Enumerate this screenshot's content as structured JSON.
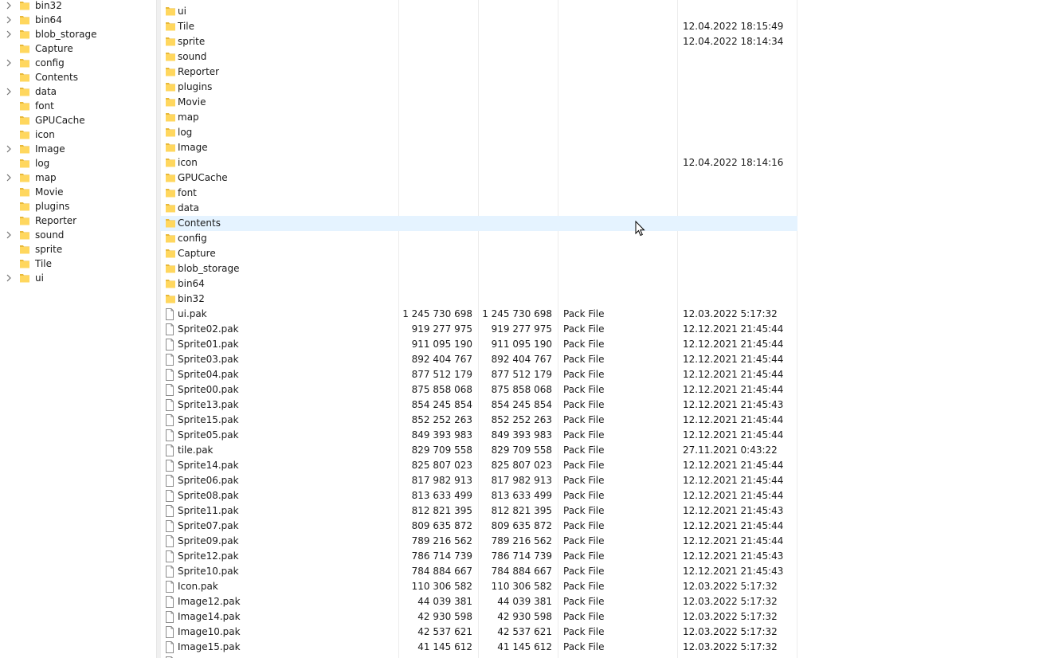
{
  "tree": [
    {
      "label": "bin32",
      "expandable": true
    },
    {
      "label": "bin64",
      "expandable": true
    },
    {
      "label": "blob_storage",
      "expandable": true
    },
    {
      "label": "Capture",
      "expandable": false
    },
    {
      "label": "config",
      "expandable": true
    },
    {
      "label": "Contents",
      "expandable": false
    },
    {
      "label": "data",
      "expandable": true
    },
    {
      "label": "font",
      "expandable": false
    },
    {
      "label": "GPUCache",
      "expandable": false
    },
    {
      "label": "icon",
      "expandable": false
    },
    {
      "label": "Image",
      "expandable": true
    },
    {
      "label": "log",
      "expandable": false
    },
    {
      "label": "map",
      "expandable": true
    },
    {
      "label": "Movie",
      "expandable": false
    },
    {
      "label": "plugins",
      "expandable": false
    },
    {
      "label": "Reporter",
      "expandable": false
    },
    {
      "label": "sound",
      "expandable": true
    },
    {
      "label": "sprite",
      "expandable": false
    },
    {
      "label": "Tile",
      "expandable": false
    },
    {
      "label": "ui",
      "expandable": true
    }
  ],
  "files": [
    {
      "name": "ui",
      "kind": "folder",
      "size1": "",
      "size2": "",
      "type": "",
      "date": ""
    },
    {
      "name": "Tile",
      "kind": "folder",
      "size1": "",
      "size2": "",
      "type": "",
      "date": "12.04.2022 18:15:49"
    },
    {
      "name": "sprite",
      "kind": "folder",
      "size1": "",
      "size2": "",
      "type": "",
      "date": "12.04.2022 18:14:34"
    },
    {
      "name": "sound",
      "kind": "folder",
      "size1": "",
      "size2": "",
      "type": "",
      "date": ""
    },
    {
      "name": "Reporter",
      "kind": "folder",
      "size1": "",
      "size2": "",
      "type": "",
      "date": ""
    },
    {
      "name": "plugins",
      "kind": "folder",
      "size1": "",
      "size2": "",
      "type": "",
      "date": ""
    },
    {
      "name": "Movie",
      "kind": "folder",
      "size1": "",
      "size2": "",
      "type": "",
      "date": ""
    },
    {
      "name": "map",
      "kind": "folder",
      "size1": "",
      "size2": "",
      "type": "",
      "date": ""
    },
    {
      "name": "log",
      "kind": "folder",
      "size1": "",
      "size2": "",
      "type": "",
      "date": ""
    },
    {
      "name": "Image",
      "kind": "folder",
      "size1": "",
      "size2": "",
      "type": "",
      "date": ""
    },
    {
      "name": "icon",
      "kind": "folder",
      "size1": "",
      "size2": "",
      "type": "",
      "date": "12.04.2022 18:14:16"
    },
    {
      "name": "GPUCache",
      "kind": "folder",
      "size1": "",
      "size2": "",
      "type": "",
      "date": ""
    },
    {
      "name": "font",
      "kind": "folder",
      "size1": "",
      "size2": "",
      "type": "",
      "date": ""
    },
    {
      "name": "data",
      "kind": "folder",
      "size1": "",
      "size2": "",
      "type": "",
      "date": ""
    },
    {
      "name": "Contents",
      "kind": "folder",
      "size1": "",
      "size2": "",
      "type": "",
      "date": "",
      "hover": true
    },
    {
      "name": "config",
      "kind": "folder",
      "size1": "",
      "size2": "",
      "type": "",
      "date": ""
    },
    {
      "name": "Capture",
      "kind": "folder",
      "size1": "",
      "size2": "",
      "type": "",
      "date": ""
    },
    {
      "name": "blob_storage",
      "kind": "folder",
      "size1": "",
      "size2": "",
      "type": "",
      "date": ""
    },
    {
      "name": "bin64",
      "kind": "folder",
      "size1": "",
      "size2": "",
      "type": "",
      "date": ""
    },
    {
      "name": "bin32",
      "kind": "folder",
      "size1": "",
      "size2": "",
      "type": "",
      "date": ""
    },
    {
      "name": "ui.pak",
      "kind": "file",
      "size1": "1 245 730 698",
      "size2": "1 245 730 698",
      "type": "Pack File",
      "date": "12.03.2022 5:17:32"
    },
    {
      "name": "Sprite02.pak",
      "kind": "file",
      "size1": "919 277 975",
      "size2": "919 277 975",
      "type": "Pack File",
      "date": "12.12.2021 21:45:44"
    },
    {
      "name": "Sprite01.pak",
      "kind": "file",
      "size1": "911 095 190",
      "size2": "911 095 190",
      "type": "Pack File",
      "date": "12.12.2021 21:45:44"
    },
    {
      "name": "Sprite03.pak",
      "kind": "file",
      "size1": "892 404 767",
      "size2": "892 404 767",
      "type": "Pack File",
      "date": "12.12.2021 21:45:44"
    },
    {
      "name": "Sprite04.pak",
      "kind": "file",
      "size1": "877 512 179",
      "size2": "877 512 179",
      "type": "Pack File",
      "date": "12.12.2021 21:45:44"
    },
    {
      "name": "Sprite00.pak",
      "kind": "file",
      "size1": "875 858 068",
      "size2": "875 858 068",
      "type": "Pack File",
      "date": "12.12.2021 21:45:44"
    },
    {
      "name": "Sprite13.pak",
      "kind": "file",
      "size1": "854 245 854",
      "size2": "854 245 854",
      "type": "Pack File",
      "date": "12.12.2021 21:45:43"
    },
    {
      "name": "Sprite15.pak",
      "kind": "file",
      "size1": "852 252 263",
      "size2": "852 252 263",
      "type": "Pack File",
      "date": "12.12.2021 21:45:44"
    },
    {
      "name": "Sprite05.pak",
      "kind": "file",
      "size1": "849 393 983",
      "size2": "849 393 983",
      "type": "Pack File",
      "date": "12.12.2021 21:45:44"
    },
    {
      "name": "tile.pak",
      "kind": "file",
      "size1": "829 709 558",
      "size2": "829 709 558",
      "type": "Pack File",
      "date": "27.11.2021 0:43:22"
    },
    {
      "name": "Sprite14.pak",
      "kind": "file",
      "size1": "825 807 023",
      "size2": "825 807 023",
      "type": "Pack File",
      "date": "12.12.2021 21:45:44"
    },
    {
      "name": "Sprite06.pak",
      "kind": "file",
      "size1": "817 982 913",
      "size2": "817 982 913",
      "type": "Pack File",
      "date": "12.12.2021 21:45:44"
    },
    {
      "name": "Sprite08.pak",
      "kind": "file",
      "size1": "813 633 499",
      "size2": "813 633 499",
      "type": "Pack File",
      "date": "12.12.2021 21:45:44"
    },
    {
      "name": "Sprite11.pak",
      "kind": "file",
      "size1": "812 821 395",
      "size2": "812 821 395",
      "type": "Pack File",
      "date": "12.12.2021 21:45:43"
    },
    {
      "name": "Sprite07.pak",
      "kind": "file",
      "size1": "809 635 872",
      "size2": "809 635 872",
      "type": "Pack File",
      "date": "12.12.2021 21:45:44"
    },
    {
      "name": "Sprite09.pak",
      "kind": "file",
      "size1": "789 216 562",
      "size2": "789 216 562",
      "type": "Pack File",
      "date": "12.12.2021 21:45:44"
    },
    {
      "name": "Sprite12.pak",
      "kind": "file",
      "size1": "786 714 739",
      "size2": "786 714 739",
      "type": "Pack File",
      "date": "12.12.2021 21:45:43"
    },
    {
      "name": "Sprite10.pak",
      "kind": "file",
      "size1": "784 884 667",
      "size2": "784 884 667",
      "type": "Pack File",
      "date": "12.12.2021 21:45:43"
    },
    {
      "name": "Icon.pak",
      "kind": "file",
      "size1": "110 306 582",
      "size2": "110 306 582",
      "type": "Pack File",
      "date": "12.03.2022 5:17:32"
    },
    {
      "name": "Image12.pak",
      "kind": "file",
      "size1": "44 039 381",
      "size2": "44 039 381",
      "type": "Pack File",
      "date": "12.03.2022 5:17:32"
    },
    {
      "name": "Image14.pak",
      "kind": "file",
      "size1": "42 930 598",
      "size2": "42 930 598",
      "type": "Pack File",
      "date": "12.03.2022 5:17:32"
    },
    {
      "name": "Image10.pak",
      "kind": "file",
      "size1": "42 537 621",
      "size2": "42 537 621",
      "type": "Pack File",
      "date": "12.03.2022 5:17:32"
    },
    {
      "name": "Image15.pak",
      "kind": "file",
      "size1": "41 145 612",
      "size2": "41 145 612",
      "type": "Pack File",
      "date": "12.03.2022 5:17:32"
    },
    {
      "name": "",
      "kind": "file",
      "size1": "",
      "size2": "",
      "type": "",
      "date": ""
    }
  ],
  "colors": {
    "folder_fill": "#ffd75e",
    "folder_tab": "#e8b93a",
    "hover_row": "#e5f3ff",
    "text": "#1a1a1a"
  }
}
